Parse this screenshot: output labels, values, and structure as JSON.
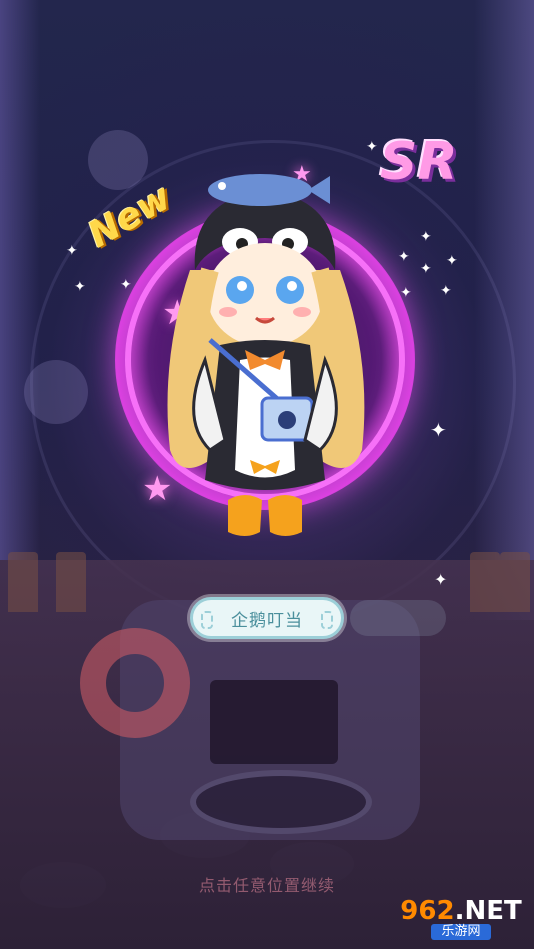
{
  "badges": {
    "new": "New",
    "rarity": "SR"
  },
  "item": {
    "name": "企鹅叮当"
  },
  "hint": "点击任意位置继续",
  "watermark": {
    "top_a": "962",
    "top_b": ".NET",
    "bottom": "乐游网"
  },
  "colors": {
    "aura": "#e65ae8",
    "pill_bg": "#e9f6f7",
    "pill_text": "#4a8f9c",
    "new_badge": "#ffd84a",
    "sr_badge": "#ff9ae6"
  },
  "icons": [
    "sparkle-star-icon",
    "pink-star-icon"
  ]
}
